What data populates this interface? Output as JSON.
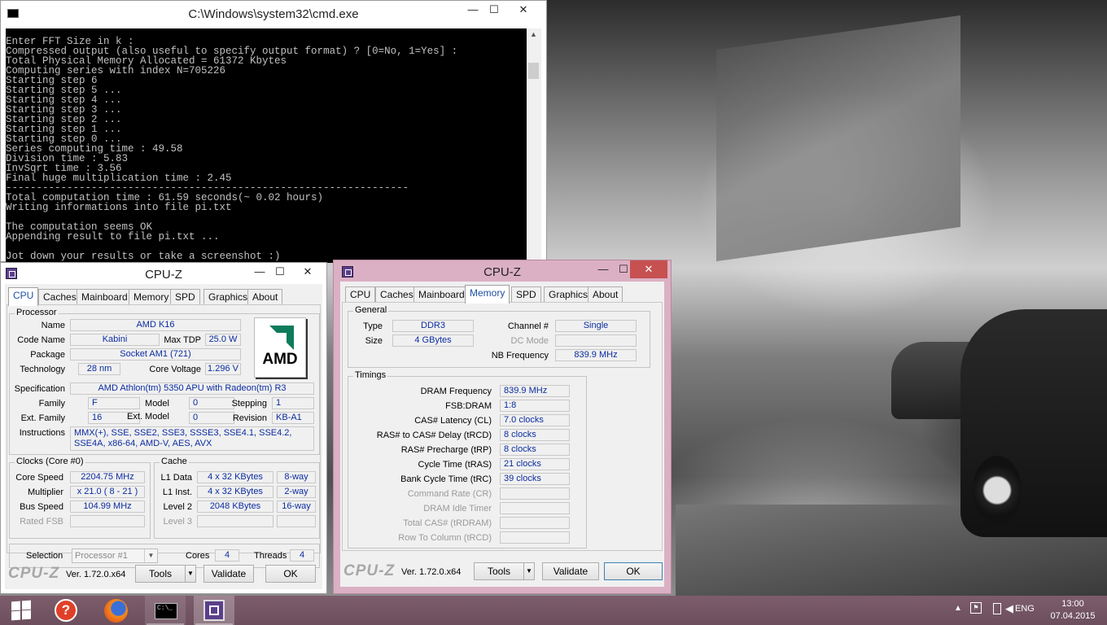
{
  "cmd": {
    "title": "C:\\Windows\\system32\\cmd.exe",
    "lines": [
      "Enter FFT Size in k :",
      "Compressed output (also useful to specify output format) ? [0=No, 1=Yes] :",
      "Total Physical Memory Allocated = 61372 Kbytes",
      "Computing series with index N=705226",
      "Starting step 6",
      "Starting step 5 ...",
      "Starting step 4 ...",
      "Starting step 3 ...",
      "Starting step 2 ...",
      "Starting step 1 ...",
      "Starting step 0 ...",
      "Series computing time : 49.58",
      "Division time : 5.83",
      "InvSqrt time : 3.56",
      "Final huge multiplication time : 2.45",
      "------------------------------------------------------------------",
      "Total computation time : 61.59 seconds(~ 0.02 hours)",
      "Writing informations into file pi.txt",
      "",
      "The computation seems OK",
      "Appending result to file pi.txt ...",
      "",
      "Jot down your results or take a screenshot :)"
    ]
  },
  "window_controls": {
    "minimize": "—",
    "maximize": "☐",
    "close": "✕"
  },
  "cpuz_common": {
    "title": "CPU-Z",
    "tabs": [
      "CPU",
      "Caches",
      "Mainboard",
      "Memory",
      "SPD",
      "Graphics",
      "About"
    ],
    "brand": "CPU-Z",
    "version": "Ver. 1.72.0.x64",
    "tools": "Tools",
    "validate": "Validate",
    "ok": "OK"
  },
  "cpu": {
    "processor_label": "Processor",
    "name_label": "Name",
    "name": "AMD K16",
    "codename_label": "Code Name",
    "codename": "Kabini",
    "maxtdp_label": "Max TDP",
    "maxtdp": "25.0 W",
    "package_label": "Package",
    "package": "Socket AM1 (721)",
    "technology_label": "Technology",
    "technology": "28 nm",
    "corevoltage_label": "Core Voltage",
    "corevoltage": "1.296 V",
    "logo_text": "AMD",
    "spec_label": "Specification",
    "spec": "AMD Athlon(tm) 5350 APU with Radeon(tm) R3",
    "family_label": "Family",
    "family": "F",
    "model_label": "Model",
    "model": "0",
    "stepping_label": "Stepping",
    "stepping": "1",
    "extfamily_label": "Ext. Family",
    "extfamily": "16",
    "extmodel_label": "Ext. Model",
    "extmodel": "0",
    "revision_label": "Revision",
    "revision": "KB-A1",
    "instructions_label": "Instructions",
    "instructions": "MMX(+), SSE, SSE2, SSE3, SSSE3, SSE4.1, SSE4.2, SSE4A, x86-64, AMD-V, AES, AVX",
    "clocks_label": "Clocks (Core #0)",
    "corespeed_label": "Core Speed",
    "corespeed": "2204.75 MHz",
    "multiplier_label": "Multiplier",
    "multiplier": "x 21.0 ( 8 - 21 )",
    "busspeed_label": "Bus Speed",
    "busspeed": "104.99 MHz",
    "ratedfsb_label": "Rated FSB",
    "cache_label": "Cache",
    "l1data_label": "L1 Data",
    "l1data": "4 x 32 KBytes",
    "l1data_way": "8-way",
    "l1inst_label": "L1 Inst.",
    "l1inst": "4 x 32 KBytes",
    "l1inst_way": "2-way",
    "level2_label": "Level 2",
    "level2": "2048 KBytes",
    "level2_way": "16-way",
    "level3_label": "Level 3",
    "selection_label": "Selection",
    "selection": "Processor #1",
    "cores_label": "Cores",
    "cores": "4",
    "threads_label": "Threads",
    "threads": "4"
  },
  "memory": {
    "general_label": "General",
    "type_label": "Type",
    "type": "DDR3",
    "size_label": "Size",
    "size": "4 GBytes",
    "channel_label": "Channel #",
    "channel": "Single",
    "dcmode_label": "DC Mode",
    "nbfreq_label": "NB Frequency",
    "nbfreq": "839.9 MHz",
    "timings_label": "Timings",
    "dram_freq_label": "DRAM Frequency",
    "dram_freq": "839.9 MHz",
    "fsb_dram_label": "FSB:DRAM",
    "fsb_dram": "1:8",
    "cl_label": "CAS# Latency (CL)",
    "cl": "7.0 clocks",
    "trcd_label": "RAS# to CAS# Delay (tRCD)",
    "trcd": "8 clocks",
    "trp_label": "RAS# Precharge (tRP)",
    "trp": "8 clocks",
    "tras_label": "Cycle Time (tRAS)",
    "tras": "21 clocks",
    "trc_label": "Bank Cycle Time (tRC)",
    "trc": "39 clocks",
    "cr_label": "Command Rate (CR)",
    "idle_label": "DRAM Idle Timer",
    "trdram_label": "Total CAS# (tRDRAM)",
    "trcd2_label": "Row To Column (tRCD)"
  },
  "taskbar": {
    "language": "ENG",
    "time": "13:00",
    "date": "07.04.2015"
  }
}
